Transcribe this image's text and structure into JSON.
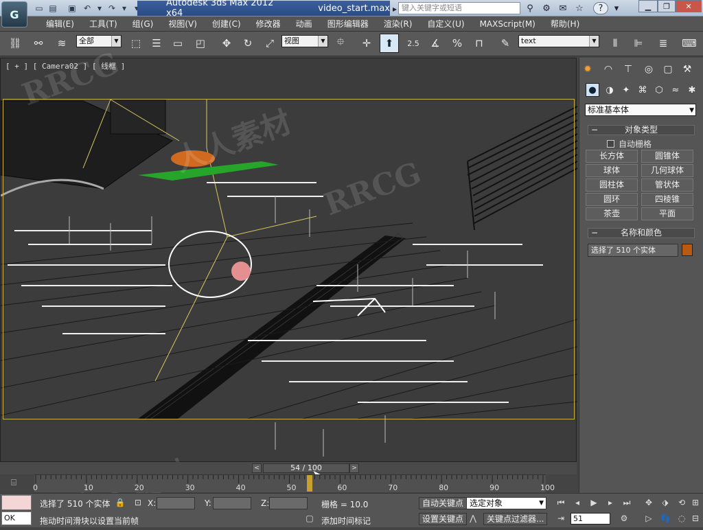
{
  "titlebar": {
    "app_title": "Autodesk 3ds Max  2012 x64",
    "file_name": "video_start.max",
    "search_placeholder": "键入关键字或短语",
    "help_label": "?"
  },
  "menubar": {
    "items": [
      "编辑(E)",
      "工具(T)",
      "组(G)",
      "视图(V)",
      "创建(C)",
      "修改器",
      "动画",
      "图形编辑器",
      "渲染(R)",
      "自定义(U)",
      "MAXScript(M)",
      "帮助(H)"
    ]
  },
  "toolbar": {
    "selection_filter": "全部",
    "reference_coord": "视图",
    "snap_angle": "2.5",
    "named_selection": "text"
  },
  "viewport": {
    "label_parts": [
      "[ + ]",
      "[ Camera02 ]",
      "[ 线框 ]"
    ],
    "watermark": "RRCG",
    "watermark_cn": "人人素材"
  },
  "command_panel": {
    "category": "标准基本体",
    "object_type_title": "对象类型",
    "autogrid_label": "自动栅格",
    "object_buttons": [
      "长方体",
      "圆锥体",
      "球体",
      "几何球体",
      "圆柱体",
      "管状体",
      "圆环",
      "四棱锥",
      "茶壶",
      "平面"
    ],
    "name_color_title": "名称和颜色",
    "name_value": "选择了 510 个实体",
    "object_color": "#b85a12"
  },
  "timeline": {
    "current_frame": 54,
    "total_frames": 100,
    "frame_display": "54 / 100",
    "ticks": [
      "0",
      "10",
      "20",
      "30",
      "40",
      "50",
      "60",
      "70",
      "80",
      "90",
      "100"
    ]
  },
  "status": {
    "listener_text": "OK",
    "selection_status": "选择了 510 个实体",
    "prompt": "拖动时间滑块以设置当前帧",
    "x_label": "X:",
    "y_label": "Y:",
    "z_label": "Z:",
    "grid_label": "栅格 = 10.0",
    "add_time_tag": "添加时间标记",
    "auto_key": "自动关键点",
    "set_key": "设置关键点",
    "key_mode_select": "选定对象",
    "key_filters": "关键点过滤器...",
    "frame_field": "51"
  }
}
